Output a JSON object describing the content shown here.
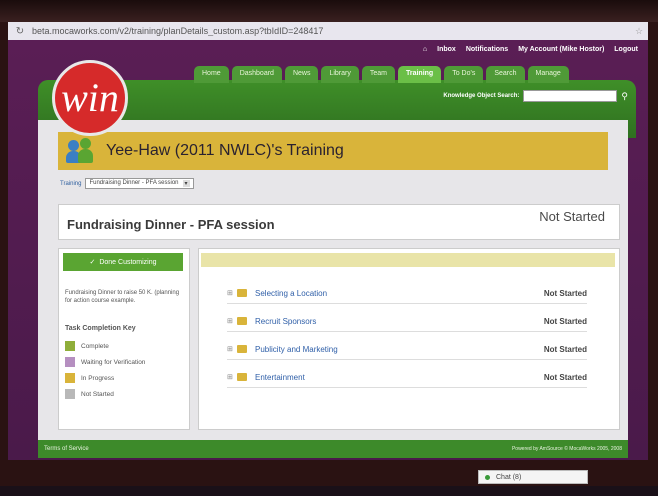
{
  "browser": {
    "url": "beta.mocaworks.com/v2/training/planDetails_custom.asp?tbIdID=248417"
  },
  "top_links": [
    "Inbox",
    "Notifications",
    "My Account (Mike Hostor)",
    "Logout"
  ],
  "logo": {
    "text": "win"
  },
  "tabs": [
    "Home",
    "Dashboard",
    "News",
    "Library",
    "Team",
    "Training",
    "To Do's",
    "Search",
    "Manage"
  ],
  "active_tab": "Training",
  "search_label": "Knowledge Object Search:",
  "page": {
    "title": "Yee-Haw (2011 NWLC)'s Training",
    "breadcrumb_link": "Training",
    "breadcrumb_select": "Fundraising Dinner - PFA session"
  },
  "session": {
    "title": "Fundraising Dinner - PFA session",
    "status": "Not Started"
  },
  "left_panel": {
    "done_button": "Done Customizing",
    "description": "Fundraising Dinner to raise 50 K. (planning for action course example.",
    "key_title": "Task Completion Key",
    "keys": [
      {
        "label": "Complete",
        "color": "#8fae3a"
      },
      {
        "label": "Waiting for Verification",
        "color": "#b58fc0"
      },
      {
        "label": "In Progress",
        "color": "#d9b43a"
      },
      {
        "label": "Not Started",
        "color": "#b8b8b8"
      }
    ]
  },
  "tasks": [
    {
      "label": "Selecting a Location",
      "status": "Not Started"
    },
    {
      "label": "Recruit Sponsors",
      "status": "Not Started"
    },
    {
      "label": "Publicity and Marketing",
      "status": "Not Started"
    },
    {
      "label": "Entertainment",
      "status": "Not Started"
    }
  ],
  "footer": {
    "tos": "Terms of Service",
    "powered": "Powered by AmSource © MocaWorks 2005, 2008"
  },
  "chat": {
    "label": "Chat (8)"
  }
}
